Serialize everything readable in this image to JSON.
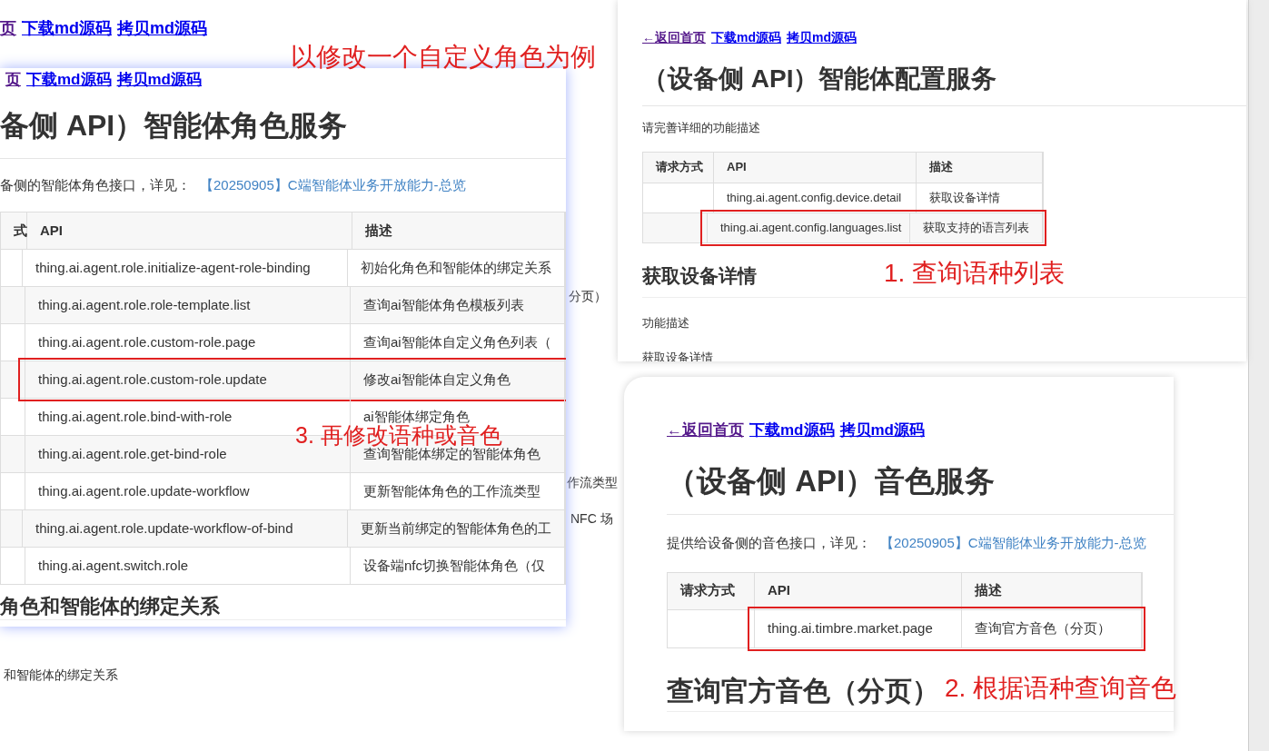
{
  "annotation": "以修改一个自定义角色为例",
  "background_page": {
    "links": [
      {
        "text": "页",
        "visited": true
      },
      {
        "text": "下载md源码",
        "visited": false
      },
      {
        "text": "拷贝md源码",
        "visited": false
      }
    ],
    "table_fragments": [
      "分页）",
      "作流类型",
      "NFC 场"
    ],
    "paragraph": "和智能体的绑定关系"
  },
  "panels": [
    {
      "links": [
        {
          "text": "页",
          "visited": true
        },
        {
          "text": "下载md源码",
          "visited": false
        },
        {
          "text": "拷贝md源码",
          "visited": false
        }
      ],
      "title": "备侧 API）智能体角色服务",
      "intro": {
        "text": "备侧的智能体角色接口，详见：",
        "link": "【20250905】C端智能体业务开放能力-总览"
      },
      "table": {
        "columns": [
          "式",
          "API",
          "描述"
        ],
        "rows": [
          {
            "cells": [
              "",
              "thing.ai.agent.role.initialize-agent-role-binding",
              "初始化角色和智能体的绑定关系"
            ],
            "highlighted": false
          },
          {
            "cells": [
              "",
              "thing.ai.agent.role.role-template.list",
              "查询ai智能体角色模板列表"
            ],
            "highlighted": false
          },
          {
            "cells": [
              "",
              "thing.ai.agent.role.custom-role.page",
              "查询ai智能体自定义角色列表（"
            ],
            "highlighted": false
          },
          {
            "cells": [
              "",
              "thing.ai.agent.role.custom-role.update",
              "修改ai智能体自定义角色"
            ],
            "highlighted": true
          },
          {
            "cells": [
              "",
              "thing.ai.agent.role.bind-with-role",
              "ai智能体绑定角色"
            ],
            "highlighted": false
          },
          {
            "cells": [
              "",
              "thing.ai.agent.role.get-bind-role",
              "查询智能体绑定的智能体角色"
            ],
            "highlighted": false
          },
          {
            "cells": [
              "",
              "thing.ai.agent.role.update-workflow",
              "更新智能体角色的工作流类型"
            ],
            "highlighted": false
          },
          {
            "cells": [
              "",
              "thing.ai.agent.role.update-workflow-of-bind",
              "更新当前绑定的智能体角色的工"
            ],
            "highlighted": false
          },
          {
            "cells": [
              "",
              "thing.ai.agent.switch.role",
              "设备端nfc切换智能体角色（仅"
            ],
            "highlighted": false
          }
        ]
      },
      "sections": [
        {
          "kind": "heading",
          "text": "角色和智能体的绑定关系"
        }
      ],
      "callout": "3. 再修改语种或音色"
    },
    {
      "links": [
        {
          "text": "←返回首页",
          "visited": true
        },
        {
          "text": "下载md源码",
          "visited": false
        },
        {
          "text": "拷贝md源码",
          "visited": false
        }
      ],
      "title": "（设备侧 API）智能体配置服务",
      "intro": {
        "text": "请完善详细的功能描述"
      },
      "table": {
        "columns": [
          "请求方式",
          "API",
          "描述"
        ],
        "rows": [
          {
            "cells": [
              "",
              "thing.ai.agent.config.device.detail",
              "获取设备详情"
            ],
            "highlighted": false
          },
          {
            "cells": [
              "",
              "thing.ai.agent.config.languages.list",
              "获取支持的语言列表"
            ],
            "highlighted": true
          }
        ]
      },
      "sections": [
        {
          "kind": "heading",
          "text": "获取设备详情"
        },
        {
          "kind": "label",
          "text": "功能描述"
        },
        {
          "kind": "text",
          "text": "获取设备详情"
        }
      ],
      "callout": "1. 查询语种列表"
    },
    {
      "links": [
        {
          "text": "←返回首页",
          "visited": true
        },
        {
          "text": "下载md源码",
          "visited": false
        },
        {
          "text": "拷贝md源码",
          "visited": false
        }
      ],
      "title": "（设备侧 API）音色服务",
      "intro": {
        "text": "提供给设备侧的音色接口，详见：",
        "link": "【20250905】C端智能体业务开放能力-总览"
      },
      "table": {
        "columns": [
          "请求方式",
          "API",
          "描述"
        ],
        "rows": [
          {
            "cells": [
              "",
              "thing.ai.timbre.market.page",
              "查询官方音色（分页）"
            ],
            "highlighted": true
          }
        ]
      },
      "sections": [
        {
          "kind": "heading",
          "text": "查询官方音色（分页）"
        }
      ],
      "callout": "2. 根据语种查询音色"
    }
  ]
}
